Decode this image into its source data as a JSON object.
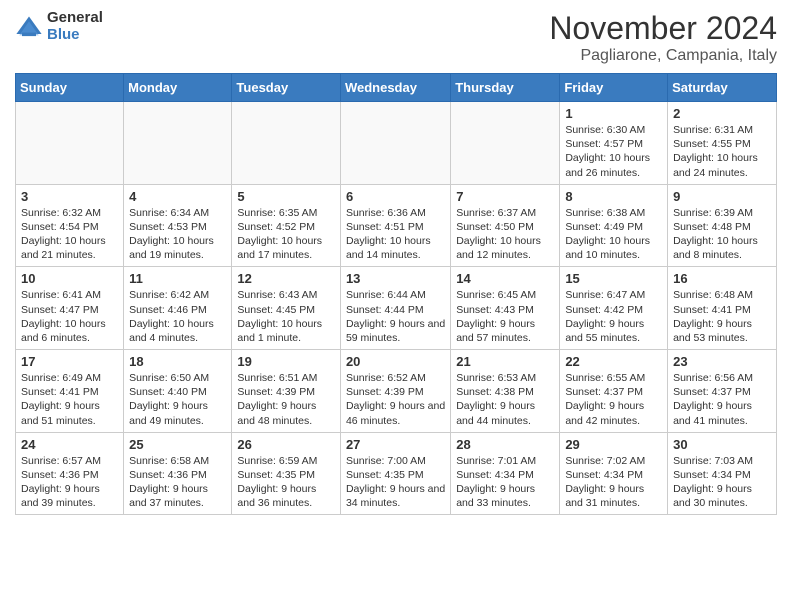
{
  "logo": {
    "general": "General",
    "blue": "Blue"
  },
  "title": "November 2024",
  "location": "Pagliarone, Campania, Italy",
  "days_of_week": [
    "Sunday",
    "Monday",
    "Tuesday",
    "Wednesday",
    "Thursday",
    "Friday",
    "Saturday"
  ],
  "weeks": [
    [
      {
        "day": "",
        "info": ""
      },
      {
        "day": "",
        "info": ""
      },
      {
        "day": "",
        "info": ""
      },
      {
        "day": "",
        "info": ""
      },
      {
        "day": "",
        "info": ""
      },
      {
        "day": "1",
        "info": "Sunrise: 6:30 AM\nSunset: 4:57 PM\nDaylight: 10 hours and 26 minutes."
      },
      {
        "day": "2",
        "info": "Sunrise: 6:31 AM\nSunset: 4:55 PM\nDaylight: 10 hours and 24 minutes."
      }
    ],
    [
      {
        "day": "3",
        "info": "Sunrise: 6:32 AM\nSunset: 4:54 PM\nDaylight: 10 hours and 21 minutes."
      },
      {
        "day": "4",
        "info": "Sunrise: 6:34 AM\nSunset: 4:53 PM\nDaylight: 10 hours and 19 minutes."
      },
      {
        "day": "5",
        "info": "Sunrise: 6:35 AM\nSunset: 4:52 PM\nDaylight: 10 hours and 17 minutes."
      },
      {
        "day": "6",
        "info": "Sunrise: 6:36 AM\nSunset: 4:51 PM\nDaylight: 10 hours and 14 minutes."
      },
      {
        "day": "7",
        "info": "Sunrise: 6:37 AM\nSunset: 4:50 PM\nDaylight: 10 hours and 12 minutes."
      },
      {
        "day": "8",
        "info": "Sunrise: 6:38 AM\nSunset: 4:49 PM\nDaylight: 10 hours and 10 minutes."
      },
      {
        "day": "9",
        "info": "Sunrise: 6:39 AM\nSunset: 4:48 PM\nDaylight: 10 hours and 8 minutes."
      }
    ],
    [
      {
        "day": "10",
        "info": "Sunrise: 6:41 AM\nSunset: 4:47 PM\nDaylight: 10 hours and 6 minutes."
      },
      {
        "day": "11",
        "info": "Sunrise: 6:42 AM\nSunset: 4:46 PM\nDaylight: 10 hours and 4 minutes."
      },
      {
        "day": "12",
        "info": "Sunrise: 6:43 AM\nSunset: 4:45 PM\nDaylight: 10 hours and 1 minute."
      },
      {
        "day": "13",
        "info": "Sunrise: 6:44 AM\nSunset: 4:44 PM\nDaylight: 9 hours and 59 minutes."
      },
      {
        "day": "14",
        "info": "Sunrise: 6:45 AM\nSunset: 4:43 PM\nDaylight: 9 hours and 57 minutes."
      },
      {
        "day": "15",
        "info": "Sunrise: 6:47 AM\nSunset: 4:42 PM\nDaylight: 9 hours and 55 minutes."
      },
      {
        "day": "16",
        "info": "Sunrise: 6:48 AM\nSunset: 4:41 PM\nDaylight: 9 hours and 53 minutes."
      }
    ],
    [
      {
        "day": "17",
        "info": "Sunrise: 6:49 AM\nSunset: 4:41 PM\nDaylight: 9 hours and 51 minutes."
      },
      {
        "day": "18",
        "info": "Sunrise: 6:50 AM\nSunset: 4:40 PM\nDaylight: 9 hours and 49 minutes."
      },
      {
        "day": "19",
        "info": "Sunrise: 6:51 AM\nSunset: 4:39 PM\nDaylight: 9 hours and 48 minutes."
      },
      {
        "day": "20",
        "info": "Sunrise: 6:52 AM\nSunset: 4:39 PM\nDaylight: 9 hours and 46 minutes."
      },
      {
        "day": "21",
        "info": "Sunrise: 6:53 AM\nSunset: 4:38 PM\nDaylight: 9 hours and 44 minutes."
      },
      {
        "day": "22",
        "info": "Sunrise: 6:55 AM\nSunset: 4:37 PM\nDaylight: 9 hours and 42 minutes."
      },
      {
        "day": "23",
        "info": "Sunrise: 6:56 AM\nSunset: 4:37 PM\nDaylight: 9 hours and 41 minutes."
      }
    ],
    [
      {
        "day": "24",
        "info": "Sunrise: 6:57 AM\nSunset: 4:36 PM\nDaylight: 9 hours and 39 minutes."
      },
      {
        "day": "25",
        "info": "Sunrise: 6:58 AM\nSunset: 4:36 PM\nDaylight: 9 hours and 37 minutes."
      },
      {
        "day": "26",
        "info": "Sunrise: 6:59 AM\nSunset: 4:35 PM\nDaylight: 9 hours and 36 minutes."
      },
      {
        "day": "27",
        "info": "Sunrise: 7:00 AM\nSunset: 4:35 PM\nDaylight: 9 hours and 34 minutes."
      },
      {
        "day": "28",
        "info": "Sunrise: 7:01 AM\nSunset: 4:34 PM\nDaylight: 9 hours and 33 minutes."
      },
      {
        "day": "29",
        "info": "Sunrise: 7:02 AM\nSunset: 4:34 PM\nDaylight: 9 hours and 31 minutes."
      },
      {
        "day": "30",
        "info": "Sunrise: 7:03 AM\nSunset: 4:34 PM\nDaylight: 9 hours and 30 minutes."
      }
    ]
  ]
}
